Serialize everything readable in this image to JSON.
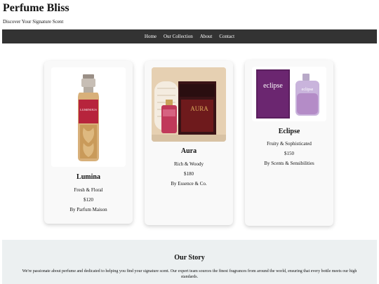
{
  "header": {
    "title": "Perfume Bliss",
    "tagline": "Discover Your Signature Scent"
  },
  "nav": {
    "items": [
      {
        "label": "Home"
      },
      {
        "label": "Our Collection"
      },
      {
        "label": "About"
      },
      {
        "label": "Contact"
      }
    ]
  },
  "products": [
    {
      "name": "Lumina",
      "notes": "Fresh & Floral",
      "price": "$120",
      "brand": "By Parfum Maison",
      "bottle_label": "LUMINOUS"
    },
    {
      "name": "Aura",
      "notes": "Rich & Woody",
      "price": "$180",
      "brand": "By Essence & Co.",
      "box_label": "AURA"
    },
    {
      "name": "Eclipse",
      "notes": "Fruity & Sophisticated",
      "price": "$150",
      "brand": "By Scents & Sensibilities",
      "box_label": "eclipse",
      "bottle_label": "eclipse"
    }
  ],
  "story": {
    "title": "Our Story",
    "text": "We're passionate about perfume and dedicated to helping you find your signature scent. Our expert team sources the finest fragrances from around the world, ensuring that every bottle meets our high standards."
  },
  "colors": {
    "navbar": "#333333",
    "card_bg": "#f9f9f9",
    "story_bg": "#ecf0f1"
  }
}
